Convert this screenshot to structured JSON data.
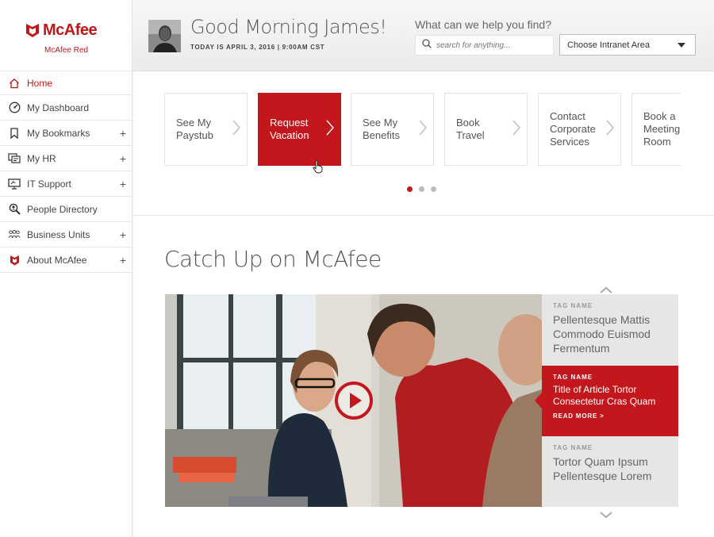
{
  "brand": {
    "name": "McAfee",
    "subtitle": "McAfee Red",
    "color": "#c4171d"
  },
  "sidebar": {
    "items": [
      {
        "label": "Home",
        "icon": "home-icon",
        "active": true,
        "expandable": false
      },
      {
        "label": "My Dashboard",
        "icon": "dashboard-gauge-icon",
        "active": false,
        "expandable": false
      },
      {
        "label": "My Bookmarks",
        "icon": "bookmark-icon",
        "active": false,
        "expandable": true
      },
      {
        "label": "My HR",
        "icon": "hr-cards-icon",
        "active": false,
        "expandable": true
      },
      {
        "label": "IT Support",
        "icon": "computer-monitor-icon",
        "active": false,
        "expandable": true
      },
      {
        "label": "People Directory",
        "icon": "person-search-icon",
        "active": false,
        "expandable": false
      },
      {
        "label": "Business Units",
        "icon": "people-group-icon",
        "active": false,
        "expandable": true
      },
      {
        "label": "About McAfee",
        "icon": "mcafee-shield-icon",
        "active": false,
        "expandable": true
      }
    ],
    "expand_symbol": "+"
  },
  "header": {
    "greeting": "Good Morning James!",
    "date": "TODAY IS APRIL 3, 2016 | 9:00AM CST",
    "help_prompt": "What can we help you find?",
    "search_placeholder": "search for anything...",
    "area_select": "Choose Intranet Area"
  },
  "quick_links": {
    "tiles": [
      {
        "label": "See My\nPaystub",
        "active": false
      },
      {
        "label": "Request\nVacation",
        "active": true
      },
      {
        "label": "See My\nBenefits",
        "active": false
      },
      {
        "label": "Book\nTravel",
        "active": false
      },
      {
        "label": "Contact\nCorporate\nServices",
        "active": false
      },
      {
        "label": "Book a\nMeeting\nRoom",
        "active": false
      }
    ],
    "pages": 3,
    "current_page": 1
  },
  "catch_up": {
    "title": "Catch Up on McAfee",
    "articles": [
      {
        "tag": "TAG NAME",
        "title": "Pellentesque Mattis\nCommodo Euismod\nFermentum",
        "active": false
      },
      {
        "tag": "TAG NAME",
        "title": "Title of Article Tortor\nConsectetur Cras Quam",
        "more": "READ MORE >",
        "active": true
      },
      {
        "tag": "TAG NAME",
        "title": "Tortor Quam Ipsum\nPellentesque Lorem",
        "active": false
      }
    ]
  }
}
